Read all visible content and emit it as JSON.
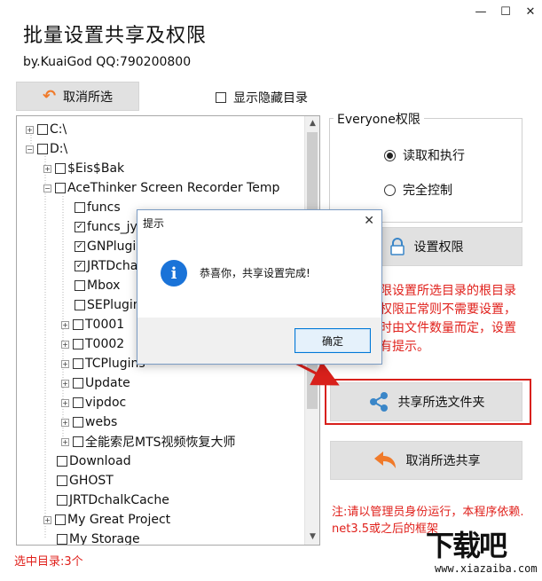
{
  "window": {
    "title": "批量设置共享及权限",
    "subtitle": "by.KuaiGod  QQ:790200800",
    "controls": [
      "—",
      "☐",
      "✕"
    ]
  },
  "toolbar": {
    "cancel_selection_label": "取消所选",
    "show_hidden_label": "显示隐藏目录"
  },
  "tree": {
    "items": [
      {
        "label": "C:\\",
        "level": 0,
        "expander": "+",
        "checked": false
      },
      {
        "label": "D:\\",
        "level": 0,
        "expander": "−",
        "checked": false
      },
      {
        "label": "$Eis$Bak",
        "level": 1,
        "expander": "+",
        "checked": false
      },
      {
        "label": "AceThinker Screen Recorder Temp",
        "level": 1,
        "expander": "−",
        "checked": false
      },
      {
        "label": "funcs",
        "level": 2,
        "expander": "",
        "checked": false
      },
      {
        "label": "funcs_jy",
        "level": 2,
        "expander": "",
        "checked": true
      },
      {
        "label": "GNPlugin",
        "level": 2,
        "expander": "",
        "checked": true
      },
      {
        "label": "JRTDchalk",
        "level": 2,
        "expander": "",
        "checked": true
      },
      {
        "label": "Mbox",
        "level": 2,
        "expander": "",
        "checked": false
      },
      {
        "label": "SEPlugin",
        "level": 2,
        "expander": "",
        "checked": false
      },
      {
        "label": "T0001",
        "level": 2,
        "expander": "+",
        "checked": false
      },
      {
        "label": "T0002",
        "level": 2,
        "expander": "+",
        "checked": false
      },
      {
        "label": "TCPlugins",
        "level": 2,
        "expander": "+",
        "checked": false
      },
      {
        "label": "Update",
        "level": 2,
        "expander": "+",
        "checked": false
      },
      {
        "label": "vipdoc",
        "level": 2,
        "expander": "+",
        "checked": false
      },
      {
        "label": "webs",
        "level": 2,
        "expander": "+",
        "checked": false
      },
      {
        "label": "全能索尼MTS视频恢复大师",
        "level": 2,
        "expander": "+",
        "checked": false
      },
      {
        "label": "Download",
        "level": 1,
        "expander": "",
        "checked": false
      },
      {
        "label": "GHOST",
        "level": 1,
        "expander": "",
        "checked": false
      },
      {
        "label": "JRTDchalkCache",
        "level": 1,
        "expander": "",
        "checked": false
      },
      {
        "label": "My Great Project",
        "level": 1,
        "expander": "+",
        "checked": false
      },
      {
        "label": "My Storage",
        "level": 1,
        "expander": "",
        "checked": false
      }
    ]
  },
  "status": {
    "selected_count": "选中目录:3个"
  },
  "permissions": {
    "group_title": "Everyone权限",
    "options": [
      {
        "label": "读取和执行",
        "selected": true
      },
      {
        "label": "完全控制",
        "selected": false
      }
    ]
  },
  "actions": {
    "set_permission_label": "设置权限",
    "share_label": "共享所选文件夹",
    "cancel_share_label": "取消所选共享"
  },
  "notes": {
    "permission_note": "限设置所选目录的根目录\n权限正常则不需要设置，\n时由文件数量而定，设置\n有提示。",
    "footer_note": "注:请以管理员身份运行，本程序依赖.\nnet3.5或之后的框架"
  },
  "dialog": {
    "title": "提示",
    "message": "恭喜你，共享设置完成!",
    "ok_label": "确定",
    "close": "✕",
    "info_glyph": "i"
  },
  "watermark": {
    "brand": "下载吧",
    "domain": "www.xiazaiba.com"
  },
  "colors": {
    "accent_red": "#e0201b",
    "info_blue": "#1a73d8",
    "button_gray": "#e1e1e1",
    "share_icon_blue": "#3a86c8",
    "undo_orange": "#f07a2a"
  }
}
